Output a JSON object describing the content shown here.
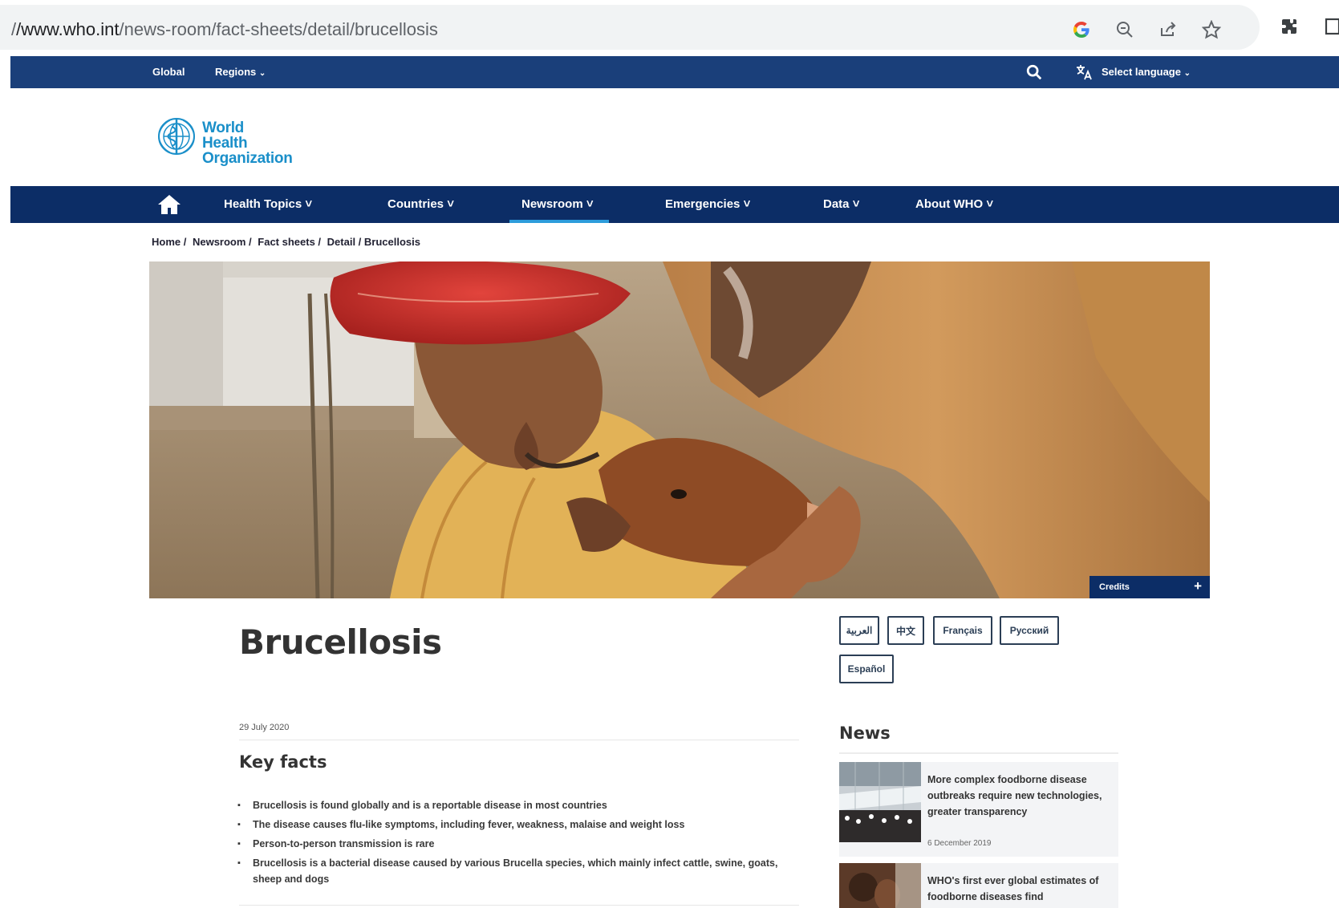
{
  "browser": {
    "url_prefix": "/",
    "url_host": "/www.who.int",
    "url_path": "/news-room/fact-sheets/detail/brucellosis"
  },
  "global_bar": {
    "global_label": "Global",
    "regions_label": "Regions",
    "select_language_label": "Select language"
  },
  "logo": {
    "line1": "World Health",
    "line2": "Organization"
  },
  "main_nav": {
    "items": [
      "Health Topics",
      "Countries",
      "Newsroom",
      "Emergencies",
      "Data",
      "About WHO"
    ],
    "active": "Newsroom"
  },
  "breadcrumb": [
    "Home /",
    "Newsroom /",
    "Fact sheets /",
    "Detail / Brucellosis"
  ],
  "hero": {
    "credits_label": "Credits",
    "credits_toggle": "+"
  },
  "article": {
    "title": "Brucellosis",
    "date": "29 July 2020",
    "key_facts_title": "Key facts",
    "key_facts": [
      "Brucellosis is found globally and is a reportable disease in most countries",
      "The disease causes flu-like symptoms, including fever, weakness, malaise and weight loss",
      "Person-to-person transmission is rare",
      "Brucellosis is a bacterial disease caused by various Brucella species, which mainly infect cattle, swine, goats, sheep and dogs"
    ]
  },
  "languages": [
    "العربية",
    "中文",
    "Français",
    "Русский",
    "Español"
  ],
  "news": {
    "title": "News",
    "items": [
      {
        "headline": "More complex foodborne disease outbreaks require new technologies, greater transparency",
        "date": "6 December 2019"
      },
      {
        "headline": "WHO's first ever global estimates of foodborne diseases find",
        "date": ""
      }
    ]
  },
  "colors": {
    "global_bar": "#1a3f7a",
    "main_nav": "#0c2d66",
    "nav_active_underline": "#2d9cdb",
    "logo_blue": "#1a8fc9"
  }
}
